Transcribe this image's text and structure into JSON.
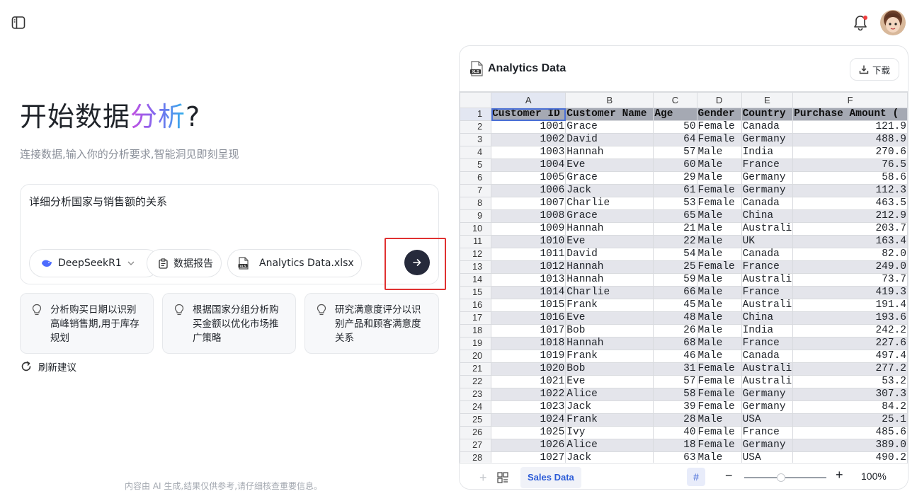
{
  "hero": {
    "title_prefix": "开始数据",
    "title_gradient": "分析",
    "title_suffix": "?",
    "subtitle": "连接数据,输入你的分析要求,智能洞见即刻呈现"
  },
  "composer": {
    "text": "详细分析国家与销售额的关系",
    "model_label": "DeepSeekR1",
    "report_label": "数据报告",
    "file_label": "Analytics Data.xlsx"
  },
  "suggestions": [
    "分析购买日期以识别高峰销售期,用于库存规划",
    "根据国家分组分析购买金额以优化市场推广策略",
    "研究满意度评分以识别产品和顾客满意度关系"
  ],
  "refresh_label": "刷新建议",
  "disclaimer": "内容由 AI 生成,结果仅供参考,请仔细核查重要信息。",
  "panel": {
    "title": "Analytics Data",
    "download_label": "下载",
    "file_icon_label": "XLS"
  },
  "spreadsheet": {
    "columns": [
      "A",
      "B",
      "C",
      "D",
      "E",
      "F"
    ],
    "header_row": [
      "Customer ID",
      "Customer Name",
      "Age",
      "Gender",
      "Country",
      "Purchase Amount ("
    ],
    "rows": [
      [
        "1001",
        "Grace",
        "50",
        "Female",
        "Canada",
        "121.9"
      ],
      [
        "1002",
        "David",
        "64",
        "Female",
        "Germany",
        "488.9"
      ],
      [
        "1003",
        "Hannah",
        "57",
        "Male",
        "India",
        "270.6"
      ],
      [
        "1004",
        "Eve",
        "60",
        "Male",
        "France",
        "76.5"
      ],
      [
        "1005",
        "Grace",
        "29",
        "Male",
        "Germany",
        "58.6"
      ],
      [
        "1006",
        "Jack",
        "61",
        "Female",
        "Germany",
        "112.3"
      ],
      [
        "1007",
        "Charlie",
        "53",
        "Female",
        "Canada",
        "463.5"
      ],
      [
        "1008",
        "Grace",
        "65",
        "Male",
        "China",
        "212.9"
      ],
      [
        "1009",
        "Hannah",
        "21",
        "Male",
        "Australi",
        "203.7"
      ],
      [
        "1010",
        "Eve",
        "22",
        "Male",
        "UK",
        "163.4"
      ],
      [
        "1011",
        "David",
        "54",
        "Male",
        "Canada",
        "82.0"
      ],
      [
        "1012",
        "Hannah",
        "25",
        "Female",
        "France",
        "249.0"
      ],
      [
        "1013",
        "Hannah",
        "59",
        "Male",
        "Australi",
        "73.7"
      ],
      [
        "1014",
        "Charlie",
        "66",
        "Male",
        "France",
        "419.3"
      ],
      [
        "1015",
        "Frank",
        "45",
        "Male",
        "Australi",
        "191.4"
      ],
      [
        "1016",
        "Eve",
        "48",
        "Male",
        "China",
        "193.6"
      ],
      [
        "1017",
        "Bob",
        "26",
        "Male",
        "India",
        "242.2"
      ],
      [
        "1018",
        "Hannah",
        "68",
        "Male",
        "France",
        "227.6"
      ],
      [
        "1019",
        "Frank",
        "46",
        "Male",
        "Canada",
        "497.4"
      ],
      [
        "1020",
        "Bob",
        "31",
        "Female",
        "Australi",
        "277.2"
      ],
      [
        "1021",
        "Eve",
        "57",
        "Female",
        "Australi",
        "53.2"
      ],
      [
        "1022",
        "Alice",
        "58",
        "Female",
        "Germany",
        "307.3"
      ],
      [
        "1023",
        "Jack",
        "39",
        "Female",
        "Germany",
        "84.2"
      ],
      [
        "1024",
        "Frank",
        "28",
        "Male",
        "USA",
        "25.1"
      ],
      [
        "1025",
        "Ivy",
        "40",
        "Female",
        "France",
        "485.6"
      ],
      [
        "1026",
        "Alice",
        "18",
        "Female",
        "Germany",
        "389.0"
      ],
      [
        "1027",
        "Jack",
        "63",
        "Male",
        "USA",
        "490.2"
      ]
    ],
    "sheet_tab": "Sales Data",
    "add_sheet": "+",
    "grid_toggle": "#",
    "zoom_minus": "−",
    "zoom_plus": "+",
    "zoom_level": "100%",
    "zoom_fraction": 0.45
  },
  "colors": {
    "send_button": "#262a3b",
    "highlight_box": "#e03131",
    "active_tab": "#2b5bd7"
  }
}
